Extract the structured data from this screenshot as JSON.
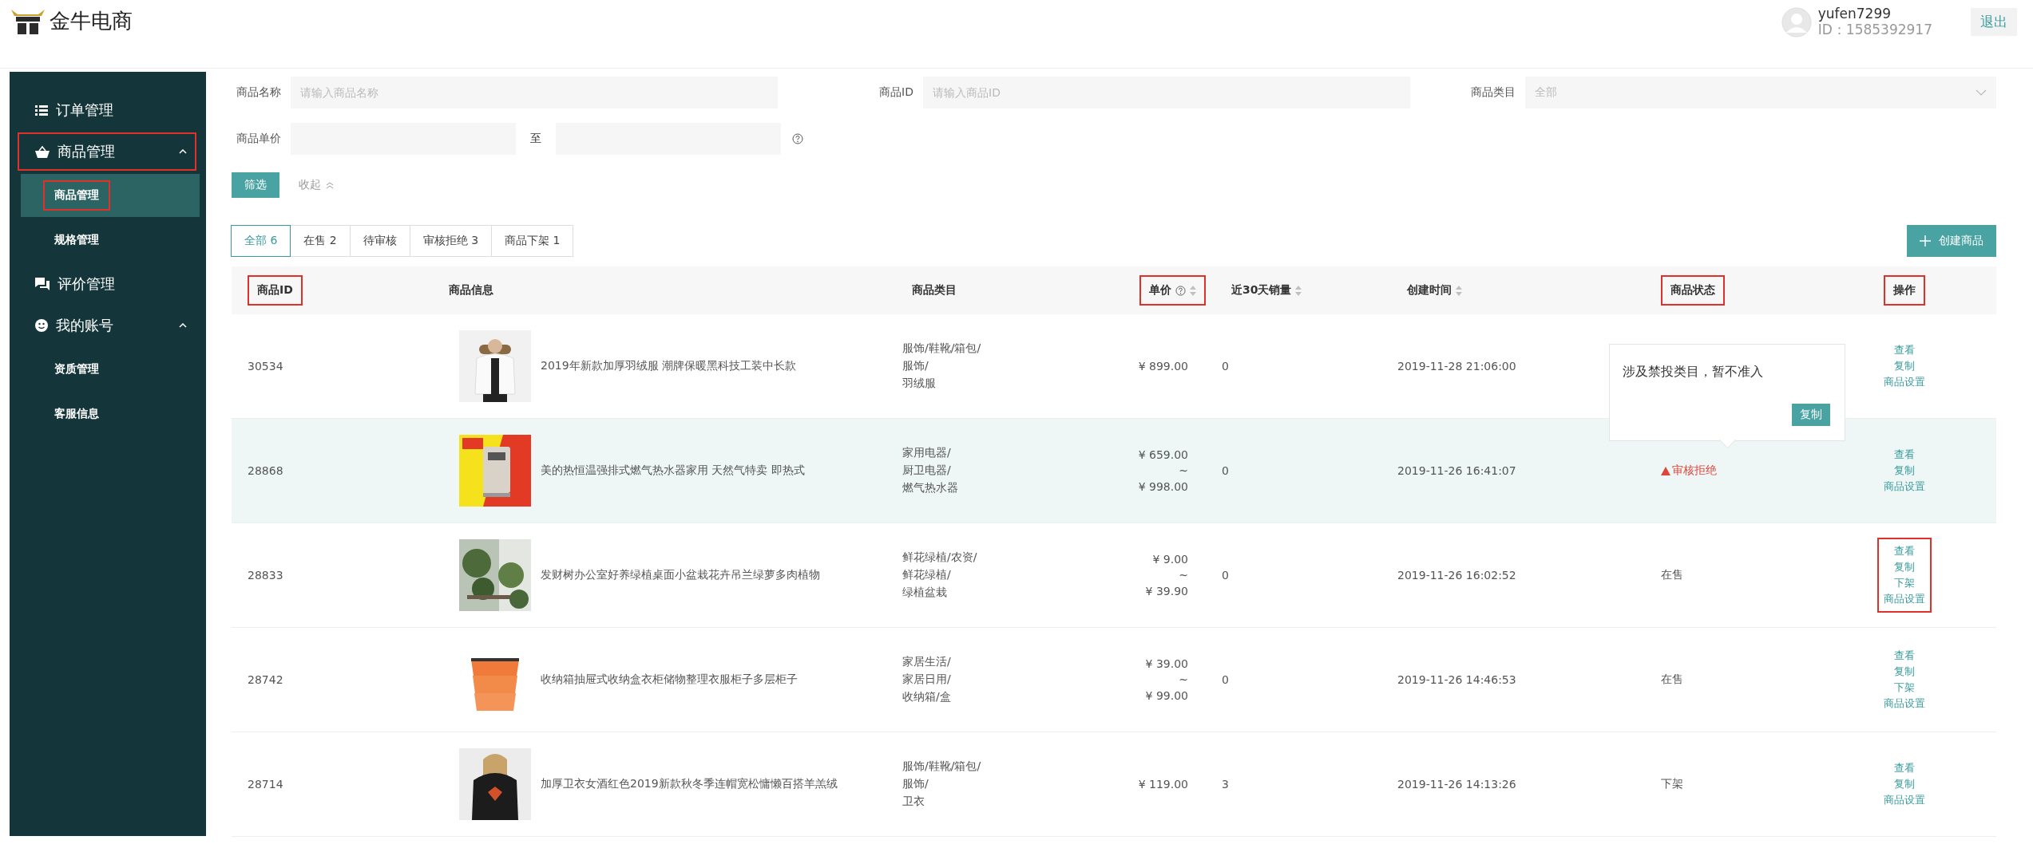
{
  "header": {
    "logo": "金牛电商",
    "user": {
      "name": "yufen7299",
      "id": "ID：1585392917"
    },
    "logout": "退出"
  },
  "sidebar": {
    "items": [
      {
        "label": "订单管理",
        "highlighted": false
      },
      {
        "label": "商品管理",
        "expanded": true,
        "highlighted": true,
        "children": [
          {
            "label": "商品管理",
            "selected": true,
            "highlighted": true
          },
          {
            "label": "规格管理",
            "selected": false,
            "highlighted": false
          }
        ]
      },
      {
        "label": "评价管理",
        "highlighted": false
      },
      {
        "label": "我的账号",
        "expanded": true,
        "highlighted": false,
        "children": [
          {
            "label": "资质管理",
            "selected": false,
            "highlighted": false
          },
          {
            "label": "客服信息",
            "selected": false,
            "highlighted": false
          }
        ]
      }
    ]
  },
  "filters": {
    "fields": [
      {
        "kind": "text",
        "label": "商品名称",
        "placeholder": "请输入商品名称"
      },
      {
        "kind": "text",
        "label": "商品ID",
        "placeholder": "请输入商品ID"
      },
      {
        "kind": "select",
        "label": "商品类目",
        "value": "全部"
      }
    ],
    "price_range": {
      "label": "商品单价",
      "separator": "至"
    },
    "filter_button": "筛选",
    "collapse_link": "收起"
  },
  "tabs": [
    {
      "label": "全部 6",
      "selected": true
    },
    {
      "label": "在售 2",
      "selected": false
    },
    {
      "label": "待审核",
      "selected": false
    },
    {
      "label": "审核拒绝 3",
      "selected": false
    },
    {
      "label": "商品下架 1",
      "selected": false
    }
  ],
  "create_button": "创建商品",
  "table": {
    "columns": [
      {
        "label": "商品ID",
        "sortable": false,
        "help": false,
        "highlighted": true
      },
      {
        "label": "商品信息",
        "sortable": false,
        "help": false,
        "highlighted": false
      },
      {
        "label": "商品类目",
        "sortable": false,
        "help": false,
        "highlighted": false
      },
      {
        "label": "单价",
        "sortable": true,
        "help": true,
        "highlighted": true
      },
      {
        "label": "近30天销量",
        "sortable": true,
        "help": false,
        "highlighted": false
      },
      {
        "label": "创建时间",
        "sortable": true,
        "help": false,
        "highlighted": false
      },
      {
        "label": "商品状态",
        "sortable": false,
        "help": false,
        "highlighted": true
      },
      {
        "label": "操作",
        "sortable": false,
        "help": false,
        "highlighted": true
      }
    ],
    "rows": [
      {
        "id": "30534",
        "title": "2019年新款加厚羽绒服 潮牌保暖黑科技工装中长款",
        "category": [
          "服饰/鞋靴/箱包/",
          "服饰/",
          "羽绒服"
        ],
        "price": [
          "¥ 899.00"
        ],
        "sales": "0",
        "created": "2019-11-28 21:06:00",
        "actions": [
          "查看",
          "复制",
          "商品设置"
        ],
        "hovered": false,
        "actions_highlighted": false
      },
      {
        "id": "28868",
        "title": "美的热恒温强排式燃气热水器家用 天然气特卖 即热式",
        "category": [
          "家用电器/",
          "厨卫电器/",
          "燃气热水器"
        ],
        "price": [
          "¥ 659.00",
          "~",
          "¥ 998.00"
        ],
        "sales": "0",
        "created": "2019-11-26 16:41:07",
        "status": {
          "kind": "rejected",
          "text": "审核拒绝"
        },
        "popover": {
          "text": "涉及禁投类目，暂不准入",
          "button": "复制"
        },
        "actions": [
          "查看",
          "复制",
          "商品设置"
        ],
        "hovered": true,
        "actions_highlighted": false
      },
      {
        "id": "28833",
        "title": "发财树办公室好养绿植桌面小盆栽花卉吊兰绿萝多肉植物",
        "category": [
          "鲜花绿植/农资/",
          "鲜花绿植/",
          "绿植盆栽"
        ],
        "price": [
          "¥ 9.00",
          "~",
          "¥ 39.90"
        ],
        "sales": "0",
        "created": "2019-11-26 16:02:52",
        "status": {
          "kind": "plain",
          "text": "在售"
        },
        "actions": [
          "查看",
          "复制",
          "下架",
          "商品设置"
        ],
        "hovered": false,
        "actions_highlighted": true
      },
      {
        "id": "28742",
        "title": "收纳箱抽屉式收纳盒衣柜储物整理衣服柜子多层柜子",
        "category": [
          "家居生活/",
          "家居日用/",
          "收纳箱/盒"
        ],
        "price": [
          "¥ 39.00",
          "~",
          "¥ 99.00"
        ],
        "sales": "0",
        "created": "2019-11-26 14:46:53",
        "status": {
          "kind": "plain",
          "text": "在售"
        },
        "actions": [
          "查看",
          "复制",
          "下架",
          "商品设置"
        ],
        "hovered": false,
        "actions_highlighted": false
      },
      {
        "id": "28714",
        "title": "加厚卫衣女酒红色2019新款秋冬季连帽宽松慵懒百搭羊羔绒",
        "category": [
          "服饰/鞋靴/箱包/",
          "服饰/",
          "卫衣"
        ],
        "price": [
          "¥ 119.00"
        ],
        "sales": "3",
        "created": "2019-11-26 14:13:26",
        "status": {
          "kind": "plain",
          "text": "下架"
        },
        "actions": [
          "查看",
          "复制",
          "商品设置"
        ],
        "hovered": false,
        "actions_highlighted": false
      }
    ]
  }
}
